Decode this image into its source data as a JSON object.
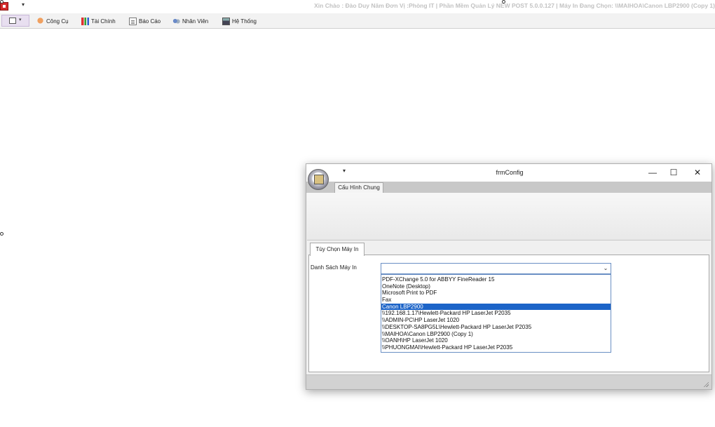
{
  "main_window": {
    "title": "Xin Chào : Đào Duy Năm Đơn Vị :Phòng IT | Phần Mềm Quản Lý NEW POST 5.0.0.127 | Máy In Đang Chọn: \\\\MAIHOA\\Canon LBP2900 (Copy 1)",
    "quick_access_arrow": "▾"
  },
  "menu": {
    "app_button_arrow": "▾",
    "items": [
      {
        "label": "Công Cụ",
        "icon": "tools-icon"
      },
      {
        "label": "Tài Chính",
        "icon": "finance-chart-icon"
      },
      {
        "label": "Báo Cáo",
        "icon": "report-icon"
      },
      {
        "label": "Nhân Viên",
        "icon": "staff-icon"
      },
      {
        "label": "Hệ Thống",
        "icon": "system-icon"
      }
    ]
  },
  "config_window": {
    "title": "frmConfig",
    "quick_access_arrow": "▾",
    "controls": {
      "minimize": "—",
      "maximize": "☐",
      "close": "✕"
    },
    "ribbon_tab": "Cấu Hình Chung",
    "page_tab": "Tùy Chọn Máy In",
    "printer_label": "Danh Sách Máy In",
    "combo_value": "",
    "combo_arrow": "⌄",
    "printers": [
      "PDF-XChange 5.0 for ABBYY FineReader 15",
      "OneNote (Desktop)",
      "Microsoft Print to PDF",
      "Fax",
      "Canon LBP2900",
      "\\\\192.168.1.17\\Hewlett-Packard HP LaserJet P2035",
      "\\\\ADMIN-PC\\HP LaserJet 1020",
      "\\\\DESKTOP-SA8PG5L\\Hewlett-Packard HP LaserJet P2035",
      "\\\\MAIHOA\\Canon LBP2900 (Copy 1)",
      "\\\\OANH\\HP LaserJet 1020",
      "\\\\PHUONGMAI\\Hewlett-Packard HP LaserJet P2035"
    ],
    "selected_printer": "Canon LBP2900"
  },
  "colors": {
    "selection": "#1c64c8",
    "title_text": "#c2c2c2",
    "combo_border": "#6a8fc4"
  }
}
